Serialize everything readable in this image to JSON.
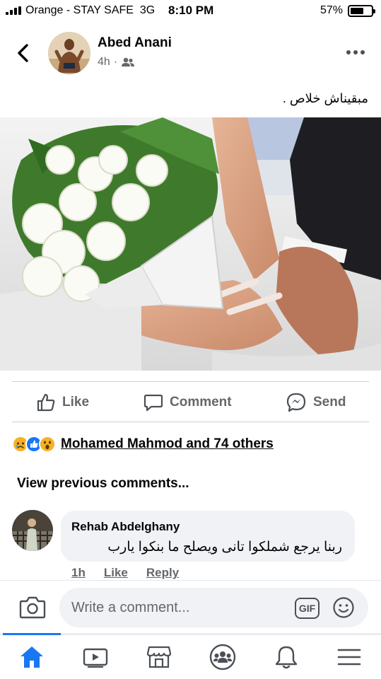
{
  "status_bar": {
    "carrier": "Orange - STAY SAFE",
    "network": "3G",
    "time": "8:10 PM",
    "battery": "57%",
    "battery_level": 0.57
  },
  "post": {
    "author": "Abed Anani",
    "time": "4h",
    "separator": "·",
    "audience_icon": "friends-icon",
    "caption": "مبقيناش خلاص .",
    "photo_icon": "wedding-photo"
  },
  "actions": {
    "like": "Like",
    "comment": "Comment",
    "send": "Send"
  },
  "reactions": {
    "icons": [
      "sad-reaction-icon",
      "like-reaction-icon",
      "wow-reaction-icon"
    ],
    "summary": "Mohamed Mahmod and 74 others"
  },
  "comments": {
    "view_previous": "View previous comments...",
    "items": [
      {
        "name": "Rehab Abdelghany",
        "text": "ربنا يرجع شملكوا تانى ويصلح ما بنكوا يارب",
        "time": "1h",
        "like": "Like",
        "reply": "Reply"
      }
    ]
  },
  "composer": {
    "placeholder": "Write a comment...",
    "gif_label": "GIF"
  },
  "nav": {
    "items": [
      "home-icon",
      "watch-icon",
      "marketplace-icon",
      "groups-icon",
      "notifications-icon",
      "menu-icon"
    ],
    "active": "home-icon"
  },
  "colors": {
    "accent": "#1877f2",
    "secondary_text": "#65676b",
    "bubble": "#f0f2f5"
  }
}
